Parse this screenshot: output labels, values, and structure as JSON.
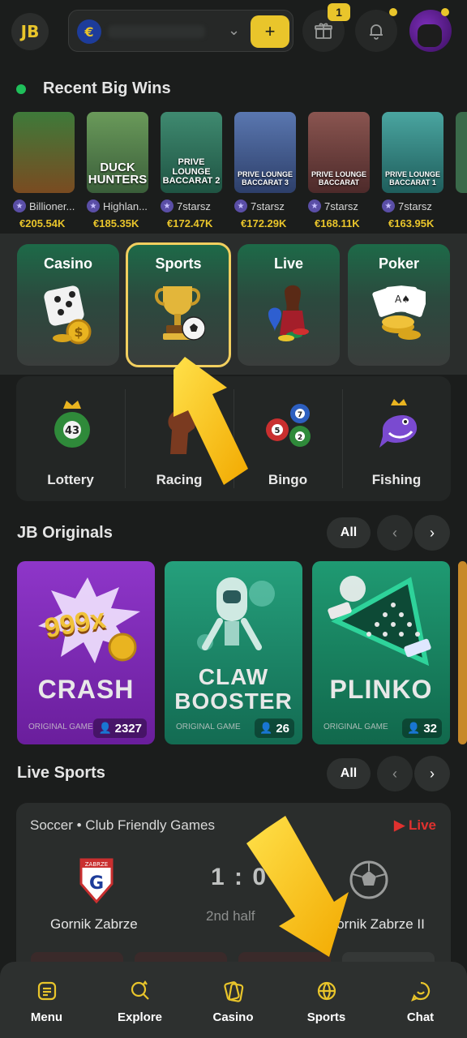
{
  "topbar": {
    "logo": "JB",
    "currency_symbol": "€",
    "deposit_label": "+",
    "notification_badge": "1",
    "icons": [
      "gift-icon",
      "bell-icon"
    ],
    "accent": "#e9c52b"
  },
  "recent_wins": {
    "title": "Recent Big Wins",
    "items": [
      {
        "thumb_text": "",
        "user": "Billioner...",
        "amount": "€205.54K",
        "bg": "#7a4b21"
      },
      {
        "thumb_text": "DUCK HUNTERS",
        "user": "Highlan...",
        "amount": "€185.35K",
        "bg": "#3a5e3a"
      },
      {
        "thumb_text": "PRIVE LOUNGE BACCARAT 2",
        "user": "7starsz",
        "amount": "€172.47K",
        "bg": "#2e6b57"
      },
      {
        "thumb_text": "PRIVE LOUNGE BACCARAT 3",
        "user": "7starsz",
        "amount": "€172.29K",
        "bg": "#3a4f7a"
      },
      {
        "thumb_text": "PRIVE LOUNGE BACCARAT",
        "user": "7starsz",
        "amount": "€168.11K",
        "bg": "#6b3a3a"
      },
      {
        "thumb_text": "PRIVE LOUNGE BACCARAT 1",
        "user": "7starsz",
        "amount": "€163.95K",
        "bg": "#2f6a6b"
      }
    ]
  },
  "categories": {
    "main": [
      "Casino",
      "Sports",
      "Live",
      "Poker"
    ],
    "selected": "Sports",
    "secondary": [
      "Lottery",
      "Racing",
      "Bingo",
      "Fishing"
    ]
  },
  "originals": {
    "title": "JB Originals",
    "all_label": "All",
    "prev": "‹",
    "next": "›",
    "items": [
      {
        "title": "CRASH",
        "badge": "999x",
        "subtitle": "ORIGINAL GAME",
        "players": "2327",
        "bg": "#7b2cb0"
      },
      {
        "title": "CLAW BOOSTER",
        "subtitle": "ORIGINAL GAME",
        "players": "26",
        "bg": "#1e8a6b"
      },
      {
        "title": "PLINKO",
        "subtitle": "ORIGINAL GAME",
        "players": "32",
        "bg": "#1a7a5c"
      }
    ]
  },
  "live_sports": {
    "title": "Live Sports",
    "all_label": "All",
    "prev": "‹",
    "next": "›",
    "match": {
      "league": "Soccer • Club Friendly Games",
      "live_label": "Live",
      "home_team": "Gornik Zabrze",
      "away_team": "Gornik Zabrze II",
      "score": "1 : 0",
      "period": "2nd half",
      "crest_text": "ZABRZE"
    }
  },
  "bottom_nav": {
    "items": [
      {
        "label": "Menu",
        "icon": "menu-icon"
      },
      {
        "label": "Explore",
        "icon": "explore-icon"
      },
      {
        "label": "Casino",
        "icon": "casino-icon"
      },
      {
        "label": "Sports",
        "icon": "sports-icon"
      },
      {
        "label": "Chat",
        "icon": "chat-icon"
      }
    ]
  }
}
